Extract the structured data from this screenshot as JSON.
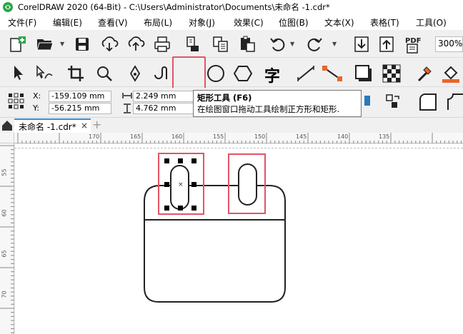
{
  "window": {
    "title": "CorelDRAW 2020 (64-Bit) - C:\\Users\\Administrator\\Documents\\未命名 -1.cdr*"
  },
  "menu": {
    "items": [
      "文件(F)",
      "编辑(E)",
      "查看(V)",
      "布局(L)",
      "对象(J)",
      "效果(C)",
      "位图(B)",
      "文本(X)",
      "表格(T)",
      "工具(O)"
    ]
  },
  "toolbar": {
    "zoom_value": "300%",
    "pdf_label": "PDF"
  },
  "property_bar": {
    "x_label": "X:",
    "y_label": "Y:",
    "x_value": "-159.109 mm",
    "y_value": "-56.215 mm",
    "width_value": "2.249 mm",
    "height_value": "4.762 mm"
  },
  "tooltip": {
    "title": "矩形工具 (F6)",
    "body": "在绘图窗口拖动工具绘制正方形和矩形."
  },
  "tabs": {
    "document_name": "未命名 -1.cdr*",
    "close_glyph": "×",
    "add_glyph": "+"
  },
  "rulers": {
    "horizontal_ticks": [
      "170",
      "165",
      "160",
      "155",
      "150",
      "145",
      "140",
      "135"
    ],
    "vertical_ticks": [
      "55",
      "60",
      "65",
      "70"
    ]
  },
  "colors": {
    "highlight": "#e35466",
    "active_tool_bg": "#cde8f7",
    "tab_accent": "#3c8fd1",
    "icon_green": "#2aa64a"
  },
  "icons": {
    "app_logo": "coreldraw-logo-icon",
    "selected_tool": "rectangle-tool-icon"
  },
  "tool_glyph": "字"
}
